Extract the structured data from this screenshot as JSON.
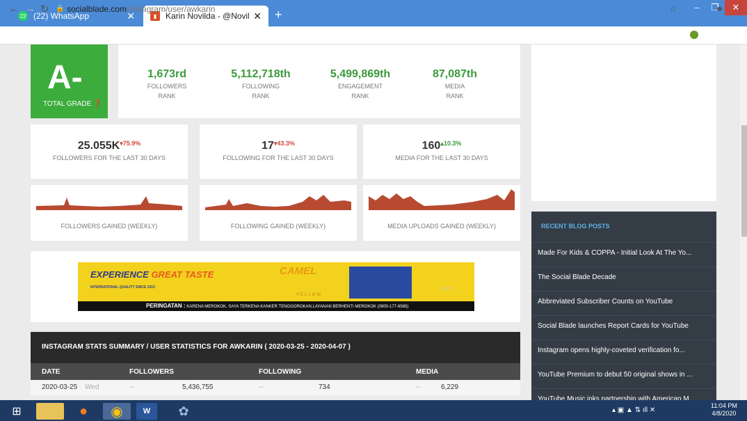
{
  "browser": {
    "tabs": [
      {
        "label": "(22) WhatsApp",
        "badge": "22"
      },
      {
        "label": "Karin Novilda - @Novilda.ID's In"
      }
    ],
    "url_host": "socialblade.com",
    "url_path": "/instagram/user/awkarin"
  },
  "grade": {
    "value": "A-",
    "label": "TOTAL GRADE"
  },
  "ranks": [
    {
      "value": "1,673rd",
      "line1": "FOLLOWERS",
      "line2": "RANK"
    },
    {
      "value": "5,112,718th",
      "line1": "FOLLOWING",
      "line2": "RANK"
    },
    {
      "value": "5,499,869th",
      "line1": "ENGAGEMENT",
      "line2": "RANK"
    },
    {
      "value": "87,087th",
      "line1": "MEDIA",
      "line2": "RANK"
    }
  ],
  "stats": [
    {
      "value": "25.055K",
      "change": "▾75.9%",
      "label": "FOLLOWERS FOR THE LAST 30 DAYS"
    },
    {
      "value": "17",
      "change": "▾43.3%",
      "label": "FOLLOWING FOR THE LAST 30 DAYS"
    },
    {
      "value": "160",
      "change": "▴10.3%",
      "label": "MEDIA FOR THE LAST 30 DAYS"
    }
  ],
  "sparks": [
    {
      "label": "FOLLOWERS GAINED (WEEKLY)"
    },
    {
      "label": "FOLLOWING GAINED (WEEKLY)"
    },
    {
      "label": "MEDIA UPLOADS GAINED (WEEKLY)"
    }
  ],
  "ad": {
    "head1": "EXPERIENCE",
    "head2": "GREAT TASTE",
    "sub": "INTERNATIONAL QUALITY SINCE 1913",
    "brand": "CAMEL",
    "brand2": "YELLOW",
    "lets": "LET'S",
    "warning_title": "PERINGATAN :",
    "warning_text": "KARENA MEROKOK, SAYA TERKENA KANKER TENGGOROKAN.LAYANAN BERHENTI MEROKOK (0800-177-6565)"
  },
  "summary": {
    "title": "INSTAGRAM STATS SUMMARY / USER STATISTICS FOR AWKARIN ( 2020-03-25 - 2020-04-07 )",
    "cols": [
      "DATE",
      "FOLLOWERS",
      "FOLLOWING",
      "MEDIA"
    ],
    "rows": [
      {
        "date": "2020-03-25",
        "day": "Wed",
        "f_change": "--",
        "followers": "5,436,755",
        "fo_change": "--",
        "following": "734",
        "m_change": "--",
        "media": "6,229"
      }
    ]
  },
  "blog": {
    "title": "RECENT BLOG POSTS",
    "posts": [
      "Made For Kids & COPPA - Initial Look At The Yo...",
      "The Social Blade Decade",
      "Abbreviated Subscriber Counts on YouTube",
      "Social Blade launches Report Cards for YouTube",
      "Instagram opens highly-coveted verification fo...",
      "YouTube Premium to debut 50 original shows in ...",
      "YouTube Music inks partnership with American M..."
    ]
  },
  "taskbar": {
    "time": "11:04 PM",
    "date": "4/8/2020"
  },
  "colors": {
    "accent_green": "#3cac3c",
    "tab_bar": "#4a8ad6",
    "chart_red": "#b84a32",
    "blog_bg": "#343d46"
  }
}
